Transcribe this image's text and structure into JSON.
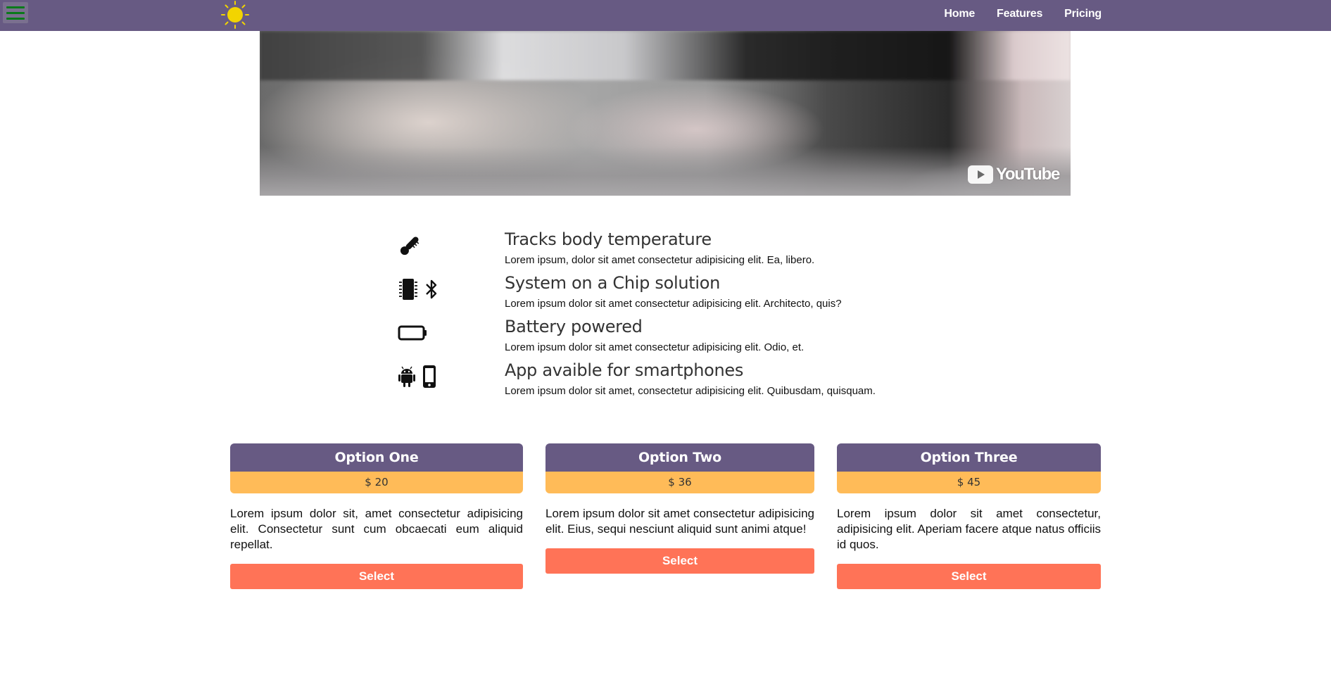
{
  "nav": {
    "items": [
      {
        "label": "Home"
      },
      {
        "label": "Features"
      },
      {
        "label": "Pricing"
      }
    ]
  },
  "video": {
    "badge_label": "YouTube"
  },
  "features": [
    {
      "title": "Tracks body temperature",
      "desc": "Lorem ipsum, dolor sit amet consectetur adipisicing elit. Ea, libero.",
      "icons": [
        "thermometer-icon"
      ]
    },
    {
      "title": "System on a Chip solution",
      "desc": "Lorem ipsum dolor sit amet consectetur adipisicing elit. Architecto, quis?",
      "icons": [
        "microchip-icon",
        "bluetooth-icon"
      ]
    },
    {
      "title": "Battery powered",
      "desc": "Lorem ipsum dolor sit amet consectetur adipisicing elit. Odio, et.",
      "icons": [
        "battery-icon"
      ]
    },
    {
      "title": "App avaible for smartphones",
      "desc": "Lorem ipsum dolor sit amet, consectetur adipisicing elit. Quibusdam, quisquam.",
      "icons": [
        "android-icon",
        "smartphone-icon"
      ]
    }
  ],
  "pricing": [
    {
      "name": "Option One",
      "price": "$ 20",
      "desc": "Lorem ipsum dolor sit, amet consectetur adipisicing elit. Consectetur sunt cum obcaecati eum aliquid repellat.",
      "button": "Select"
    },
    {
      "name": "Option Two",
      "price": "$ 36",
      "desc": "Lorem ipsum dolor sit amet consectetur adipisicing elit. Eius, sequi nesciunt aliquid sunt animi atque!",
      "button": "Select"
    },
    {
      "name": "Option Three",
      "price": "$ 45",
      "desc": "Lorem ipsum dolor sit amet consectetur, adipisicing elit. Aperiam facere atque natus officiis id quos.",
      "button": "Select"
    }
  ],
  "colors": {
    "header": "#675a83",
    "price_band": "#ffbb58",
    "button": "#ff7357",
    "logo_sun": "#f2d400",
    "menu_lines": "#0a7a1a"
  }
}
